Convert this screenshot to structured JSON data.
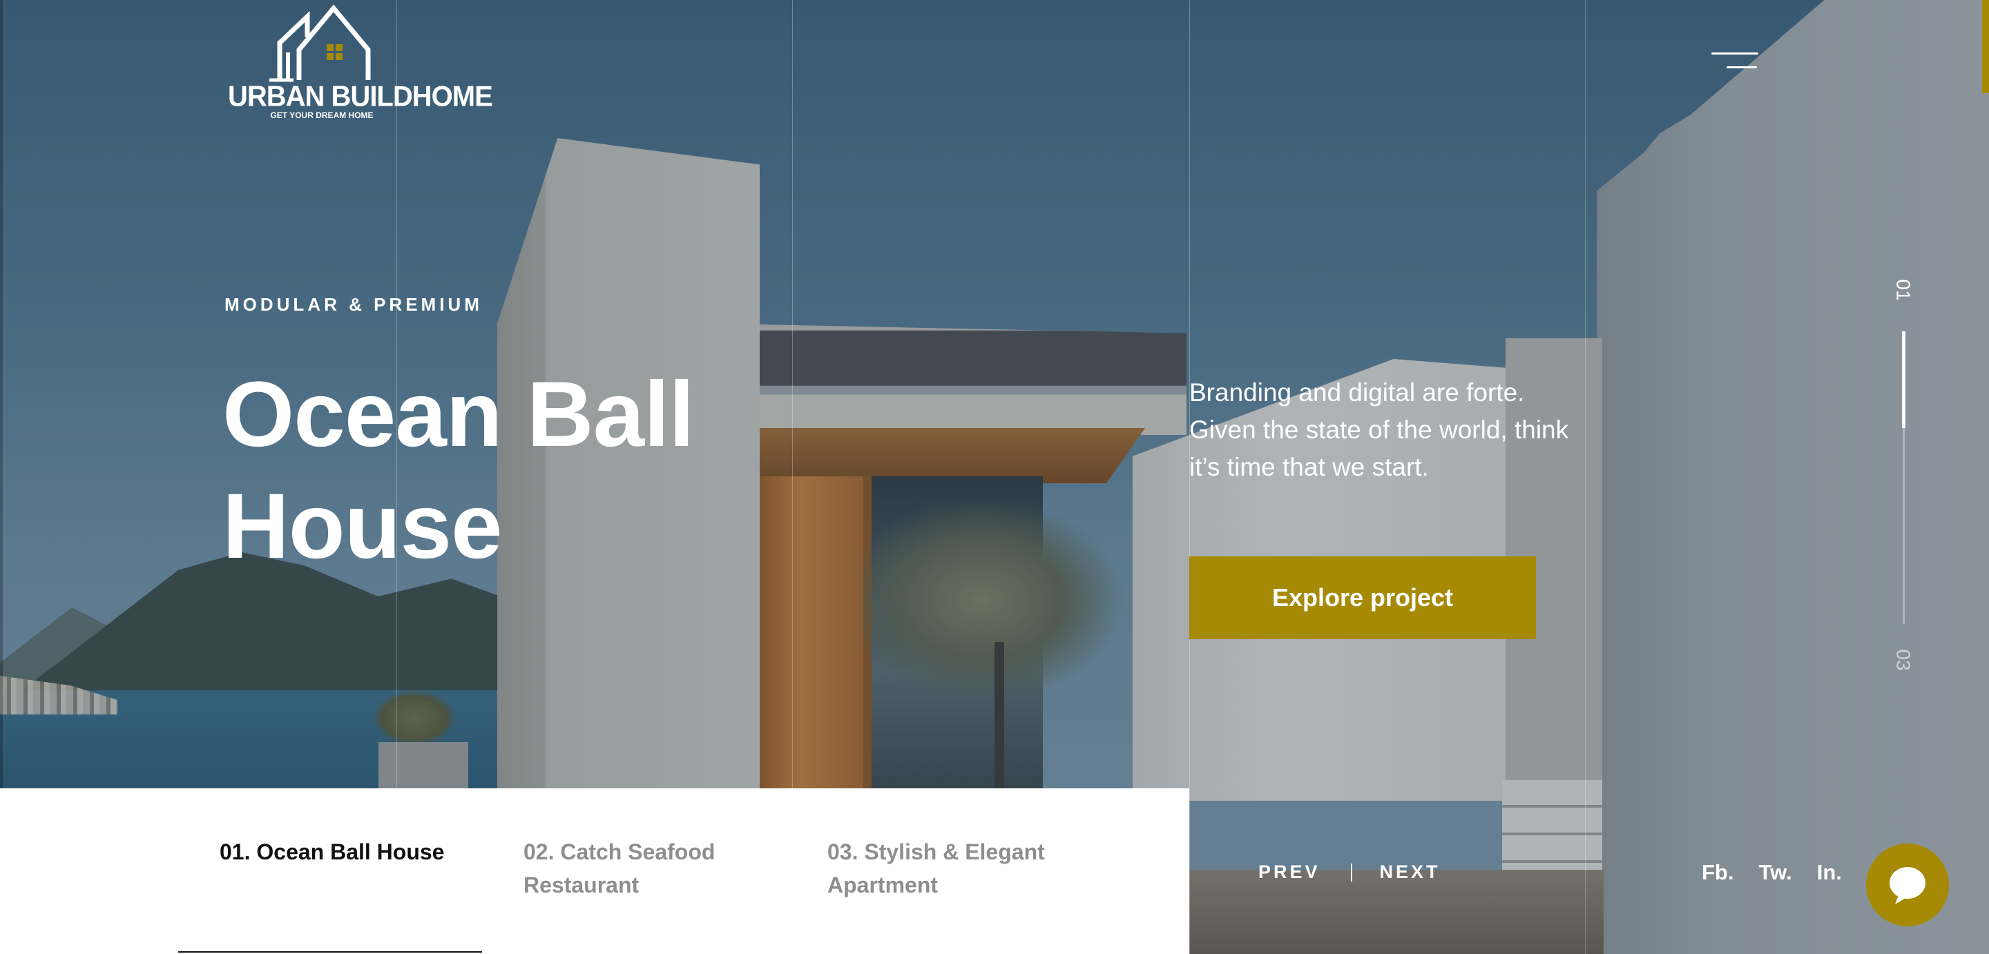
{
  "brand": {
    "name": "URBAN BUILDHOME",
    "tagline": "GET YOUR DREAM HOME",
    "accent_color": "#a68a05"
  },
  "header": {
    "menu_icon": "hamburger-menu-icon"
  },
  "hero": {
    "eyebrow": "MODULAR & PREMIUM",
    "title": "Ocean Ball House",
    "description": "Branding and digital are forte. Given the state of the world, think it’s time that we start.",
    "cta_label": "Explore project"
  },
  "slide_indicator": {
    "current": "01",
    "total": "03"
  },
  "slides": [
    {
      "label": "01. Ocean Ball House",
      "active": true
    },
    {
      "label": "02. Catch Seafood Restaurant",
      "active": false
    },
    {
      "label": "03. Stylish & Elegant Apartment",
      "active": false
    }
  ],
  "pager": {
    "prev": "PREV",
    "next": "NEXT"
  },
  "socials": [
    "Fb.",
    "Tw.",
    "In."
  ],
  "chat": {
    "icon": "chat-bubble-icon"
  }
}
